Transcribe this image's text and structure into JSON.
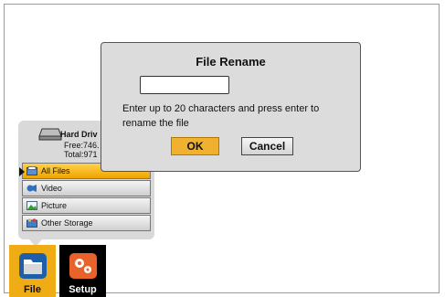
{
  "storage": {
    "drive_name": "Hard Driv",
    "free": "Free:746.",
    "total": "Total:971",
    "items": [
      {
        "label": "All Files",
        "icon": "all-files-icon",
        "selected": true
      },
      {
        "label": "Video",
        "icon": "video-icon",
        "selected": false
      },
      {
        "label": "Picture",
        "icon": "picture-icon",
        "selected": false
      },
      {
        "label": "Other Storage",
        "icon": "other-storage-icon",
        "selected": false
      }
    ]
  },
  "tabs": [
    {
      "label": "File",
      "icon": "folder-icon",
      "active": true
    },
    {
      "label": "Setup",
      "icon": "gears-icon",
      "active": false
    }
  ],
  "dialog": {
    "title": "File Rename",
    "input_value": "",
    "message": "Enter up to 20 characters and press enter to rename the file",
    "ok_label": "OK",
    "cancel_label": "Cancel"
  },
  "colors": {
    "accent": "#f0ac14",
    "dialog_bg": "#dcdcdc",
    "panel_bg": "#d9d9d9"
  }
}
